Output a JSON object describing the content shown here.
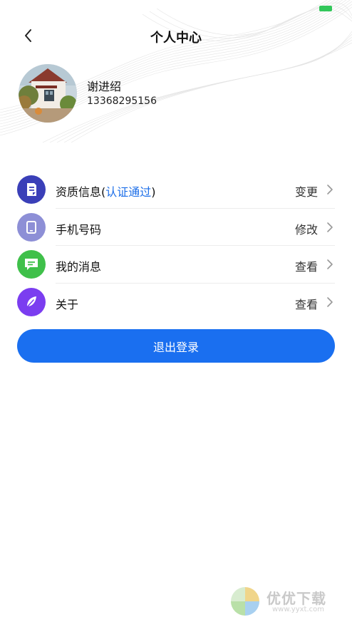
{
  "status_bar": {
    "battery_color": "#32c75a"
  },
  "nav": {
    "title": "个人中心",
    "back_icon": "chevron-left-icon"
  },
  "profile": {
    "name": "谢进绍",
    "phone": "13368295156",
    "avatar": "house-photo"
  },
  "menu": [
    {
      "label": "资质信息",
      "label_suffix": "认证通过",
      "action": "变更",
      "icon": "document-icon",
      "icon_color": "#3a3fb8"
    },
    {
      "label": "手机号码",
      "label_suffix": "",
      "action": "修改",
      "icon": "phone-icon",
      "icon_color": "#8d8fd6"
    },
    {
      "label": "我的消息",
      "label_suffix": "",
      "action": "查看",
      "icon": "message-icon",
      "icon_color": "#3fc04a"
    },
    {
      "label": "关于",
      "label_suffix": "",
      "action": "查看",
      "icon": "feather-icon",
      "icon_color": "#7b3df0"
    }
  ],
  "logout": {
    "label": "退出登录",
    "color": "#1a6ff0"
  },
  "watermark": {
    "text": "优优下载",
    "url": "www.yyxt.com"
  }
}
